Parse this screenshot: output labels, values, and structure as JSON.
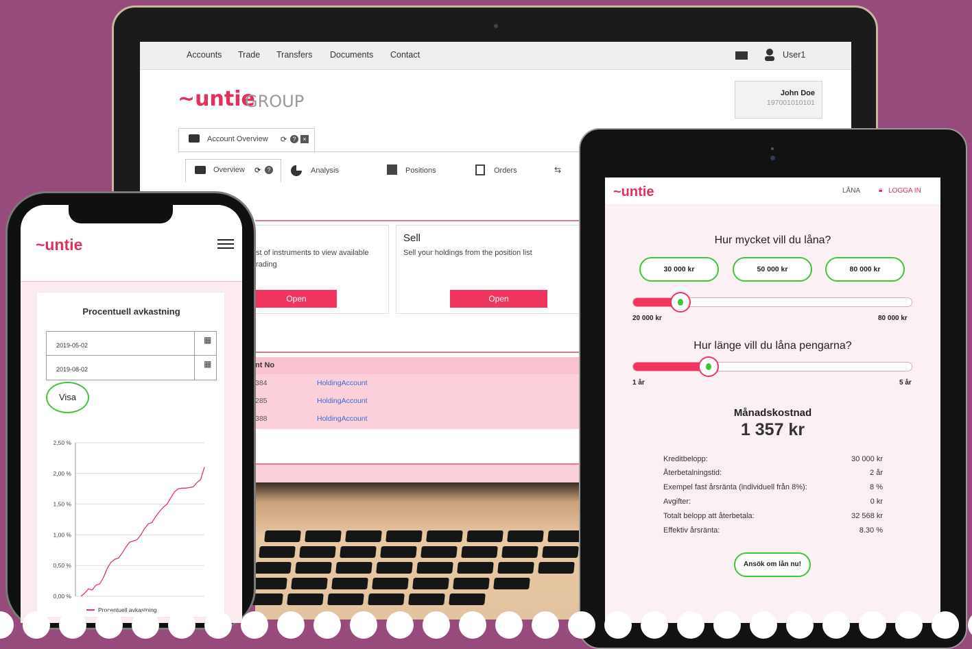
{
  "laptop": {
    "nav": [
      "Accounts",
      "Trade",
      "Transfers",
      "Documents",
      "Contact"
    ],
    "user": "User1",
    "brand": "~untie",
    "brand_suffix": "GROUP",
    "account_name": "John Doe",
    "account_id": "197001010101",
    "outer_tab": "Account Overview",
    "tabs": [
      "Overview",
      "Analysis",
      "Positions",
      "Orders"
    ],
    "buy_card_text_1": "st of instruments to view available",
    "buy_card_text_2": "rading",
    "open_label": "Open",
    "sell_title": "Sell",
    "sell_text": "Sell your holdings from the position list",
    "table_header": "nt No",
    "rows": [
      {
        "no": "384",
        "type": "HoldingAccount"
      },
      {
        "no": "285",
        "type": "HoldingAccount"
      },
      {
        "no": "388",
        "type": "HoldingAccount"
      }
    ]
  },
  "phone": {
    "brand": "~untie",
    "chart_title": "Procentuell avkastning",
    "date_from": "2019-05-02",
    "date_to": "2019-08-02",
    "show_button": "Visa"
  },
  "chart_data": {
    "type": "line",
    "title": "Procentuell avkastning",
    "ylim": [
      0,
      2.5
    ],
    "yticks": [
      "2,50 %",
      "2,00 %",
      "1,50 %",
      "1,00 %",
      "0,50 %",
      "0,00 %"
    ],
    "series": [
      {
        "name": "Procentuell avkastning",
        "color": "#e2355a",
        "values": [
          0,
          0.05,
          0.12,
          0.1,
          0.18,
          0.2,
          0.3,
          0.45,
          0.55,
          0.6,
          0.62,
          0.7,
          0.8,
          0.88,
          0.9,
          0.92,
          1.0,
          1.1,
          1.18,
          1.2,
          1.3,
          1.38,
          1.45,
          1.5,
          1.6,
          1.7,
          1.75,
          1.76,
          1.76,
          1.77,
          1.78,
          1.85,
          1.9,
          2.1
        ]
      }
    ]
  },
  "tablet": {
    "brand": "~untie",
    "nav_loan": "LÅNA",
    "nav_login": "LOGGA IN",
    "q1": "Hur mycket vill du låna?",
    "amounts": [
      "30 000 kr",
      "50 000 kr",
      "80 000 kr"
    ],
    "amount_min": "20 000 kr",
    "amount_max": "80 000 kr",
    "amount_level": 0.17,
    "q2": "Hur länge vill du låna pengarna?",
    "term_min": "1 år",
    "term_max": "5 år",
    "term_level": 0.27,
    "monthly_label": "Månadskostnad",
    "monthly_value": "1 357 kr",
    "summary": [
      {
        "label": "Kreditbelopp:",
        "value": "30 000 kr"
      },
      {
        "label": "Återbetalningstid:",
        "value": "2 år"
      },
      {
        "label": "Exempel fast årsränta (individuell från 8%):",
        "value": "8 %"
      },
      {
        "label": "Avgifter:",
        "value": "0 kr"
      },
      {
        "label": "Totalt belopp att återbetala:",
        "value": "32 568 kr"
      },
      {
        "label": "Effektiv årsränta:",
        "value": "8.30 %"
      }
    ],
    "apply_button": "Ansök om lån nu!"
  }
}
